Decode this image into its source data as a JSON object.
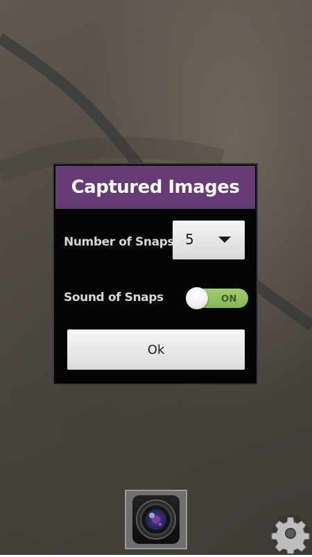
{
  "dialog": {
    "title": "Captured Images",
    "number_of_snaps_label": "Number of Snaps",
    "number_of_snaps_value": "5",
    "sound_of_snaps_label": "Sound of Snaps",
    "sound_toggle_state": "ON",
    "ok_label": "Ok"
  },
  "controls": {
    "shutter_icon": "camera-lens-icon",
    "settings_icon": "gear-icon"
  },
  "colors": {
    "header": "#663a74",
    "dialog_bg": "#050505",
    "toggle_on": "#9fce6a"
  }
}
